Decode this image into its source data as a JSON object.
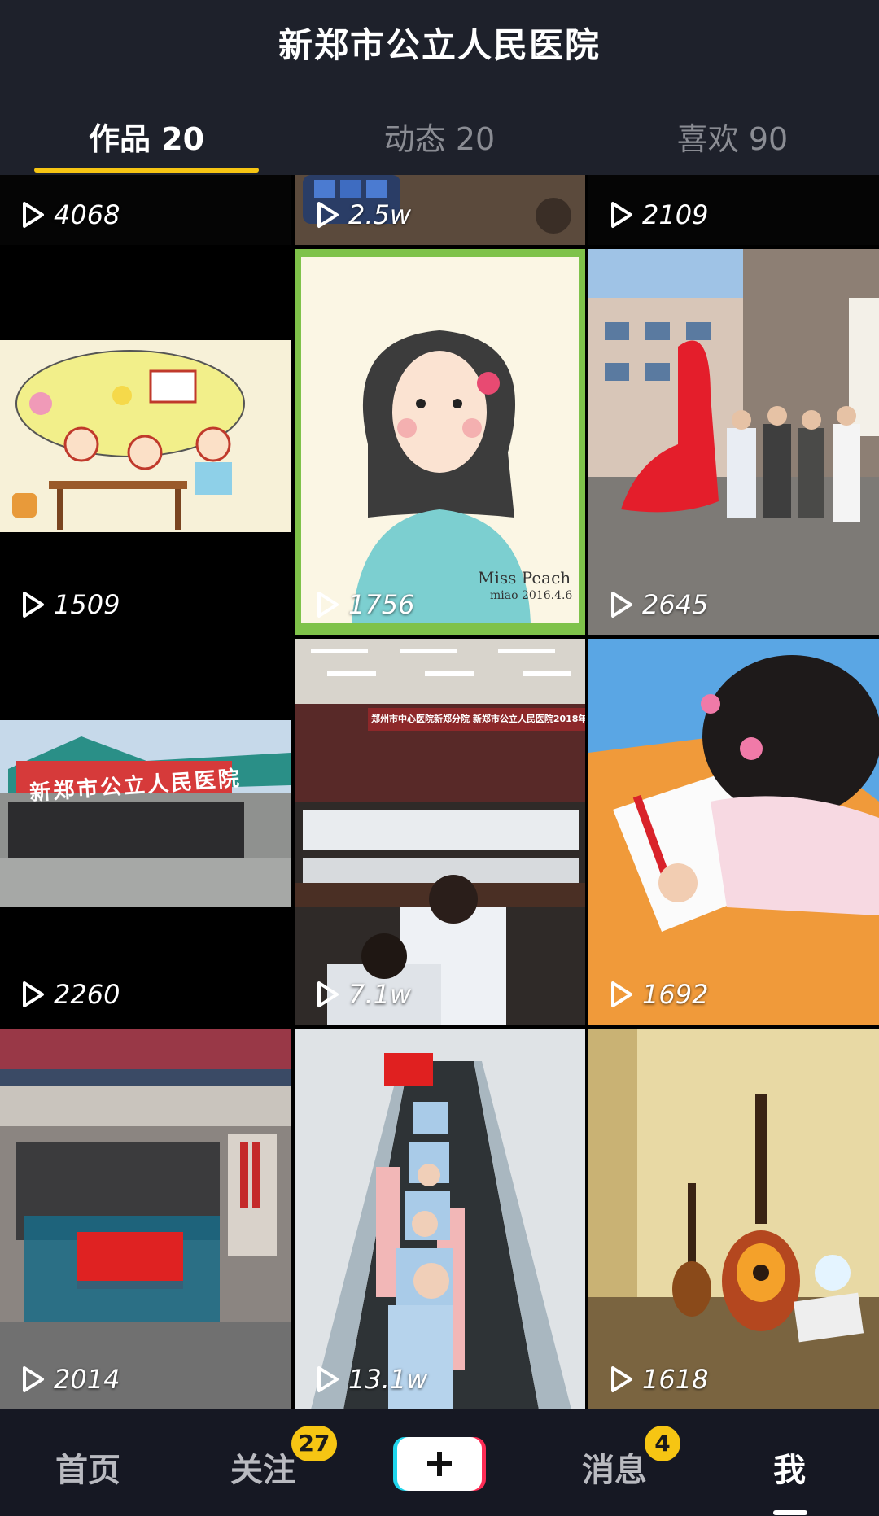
{
  "header": {
    "title": "新郑市公立人民医院",
    "tabs": [
      {
        "label": "作品 20",
        "active": true
      },
      {
        "label": "动态 20",
        "active": false
      },
      {
        "label": "喜欢 90",
        "active": false
      }
    ]
  },
  "grid": {
    "tiles": [
      {
        "count": "4068",
        "scene": "dark"
      },
      {
        "count": "2.5w",
        "scene": "phone"
      },
      {
        "count": "2109",
        "scene": "dark"
      },
      {
        "count": "1509",
        "scene": "kids-drawing"
      },
      {
        "count": "1756",
        "scene": "girl-drawing",
        "drawing_text": "Miss Peach",
        "drawing_sub": "miao 2016.4.6"
      },
      {
        "count": "2645",
        "scene": "unveiling"
      },
      {
        "count": "2260",
        "scene": "tent",
        "banner_text": "新郑市公立人民医院"
      },
      {
        "count": "7.1w",
        "scene": "hall",
        "banner_text": "郑州市中心医院新郑分院 新郑市公立人民医院2018年"
      },
      {
        "count": "1692",
        "scene": "child-writing"
      },
      {
        "count": "2014",
        "scene": "group-flag"
      },
      {
        "count": "13.1w",
        "scene": "escalator"
      },
      {
        "count": "1618",
        "scene": "guitar"
      }
    ]
  },
  "bottom_nav": {
    "home": "首页",
    "follow": "关注",
    "follow_badge": "27",
    "plus_icon": "plus-icon",
    "messages": "消息",
    "messages_badge": "4",
    "me": "我"
  },
  "colors": {
    "accent": "#f6c513",
    "header_bg": "#1e212b",
    "nav_bg": "#161823"
  }
}
